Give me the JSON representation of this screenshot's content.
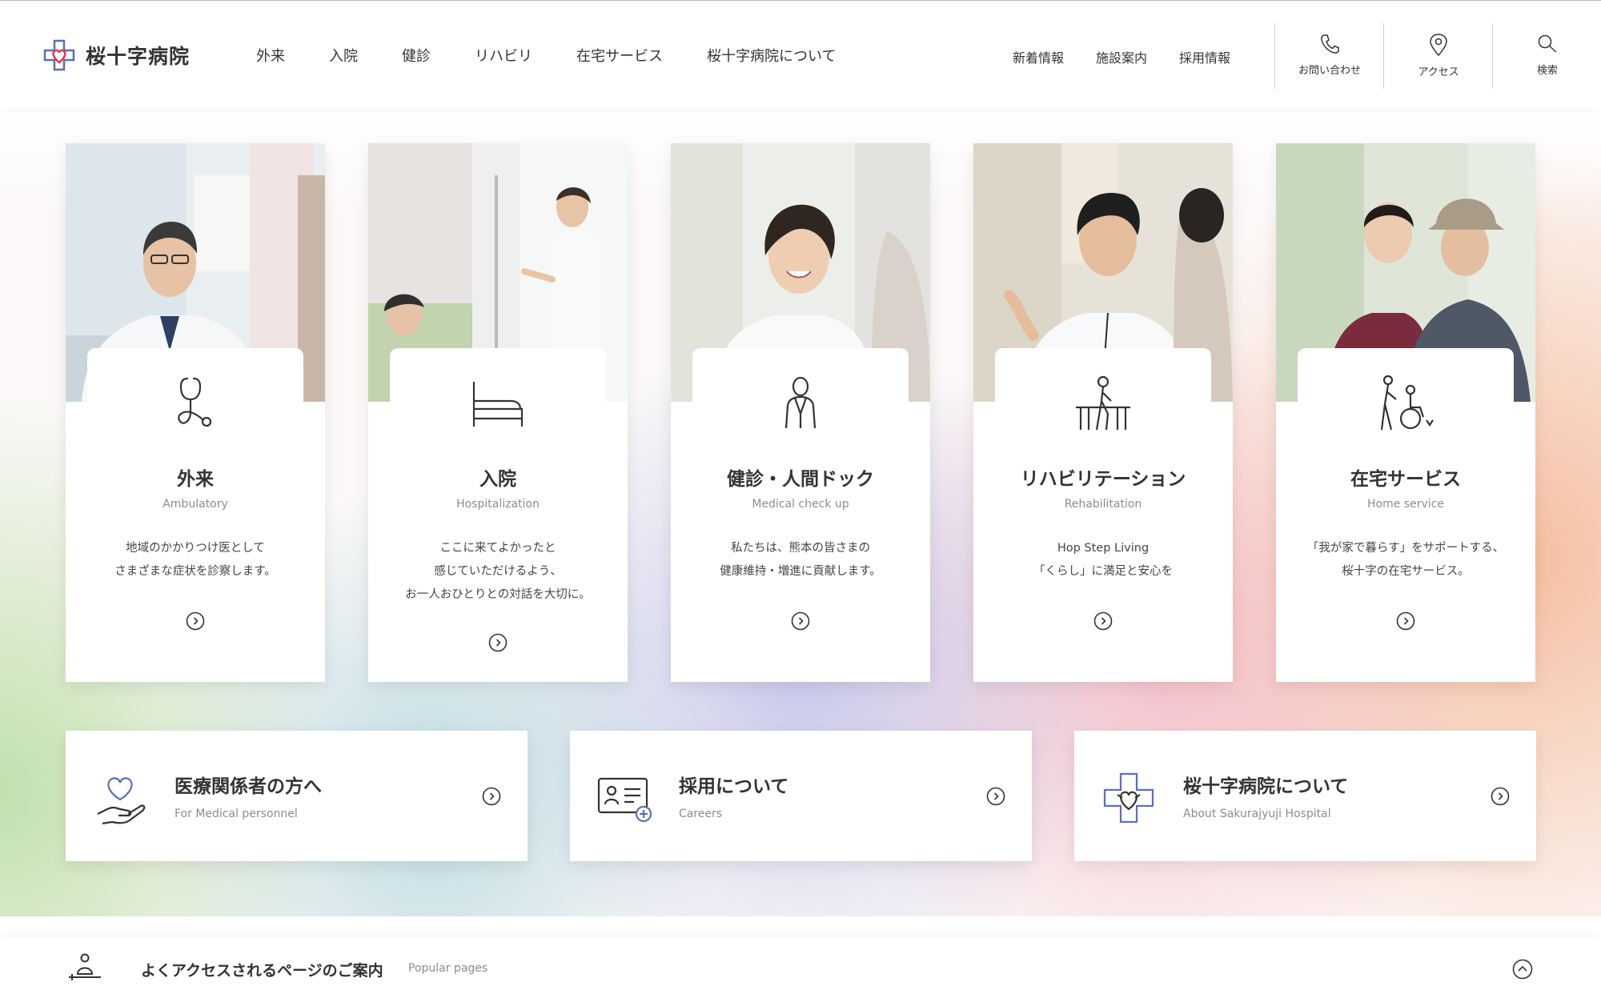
{
  "brand": {
    "name": "桜十字病院",
    "accent": "#e2384f",
    "accent2": "#5a6fb4"
  },
  "gnav": [
    "外来",
    "入院",
    "健診",
    "リハビリ",
    "在宅サービス",
    "桜十字病院について"
  ],
  "subnav": [
    "新着情報",
    "施設案内",
    "採用情報"
  ],
  "utility": [
    {
      "label": "お問い合わせ",
      "icon": "phone-icon"
    },
    {
      "label": "アクセス",
      "icon": "map-pin-icon"
    },
    {
      "label": "検索",
      "icon": "search-icon"
    }
  ],
  "cards": [
    {
      "title": "外来",
      "en": "Ambulatory",
      "desc": [
        "地域のかかりつけ医として",
        "さまざまな症状を診察します。"
      ],
      "icon": "stethoscope-icon"
    },
    {
      "title": "入院",
      "en": "Hospitalization",
      "desc": [
        "ここに来てよかったと",
        "感じていただけるよう、",
        "お一人おひとりとの対話を大切に。"
      ],
      "icon": "hospital-bed-icon"
    },
    {
      "title": "健診・人間ドック",
      "en": "Medical check up",
      "desc": [
        "私たちは、熊本の皆さまの",
        "健康維持・増進に貢献します。"
      ],
      "icon": "doctor-person-icon"
    },
    {
      "title": "リハビリテーション",
      "en": "Rehabilitation",
      "desc": [
        "Hop Step Living",
        "「くらし」に満足と安心を"
      ],
      "icon": "rehab-icon"
    },
    {
      "title": "在宅サービス",
      "en": "Home service",
      "desc": [
        "「我が家で暮らす」をサポートする、",
        "桜十字の在宅サービス。"
      ],
      "icon": "wheelchair-care-icon"
    }
  ],
  "links": [
    {
      "title": "医療関係者の方へ",
      "en": "For Medical personnel",
      "icon": "heart-hand-icon"
    },
    {
      "title": "採用について",
      "en": "Careers",
      "icon": "id-card-icon"
    },
    {
      "title": "桜十字病院について",
      "en": "About Sakurajyuji Hospital",
      "icon": "cross-heart-icon"
    }
  ],
  "popular": {
    "title": "よくアクセスされるページのご案内",
    "en": "Popular pages",
    "icon": "person-desk-icon"
  }
}
